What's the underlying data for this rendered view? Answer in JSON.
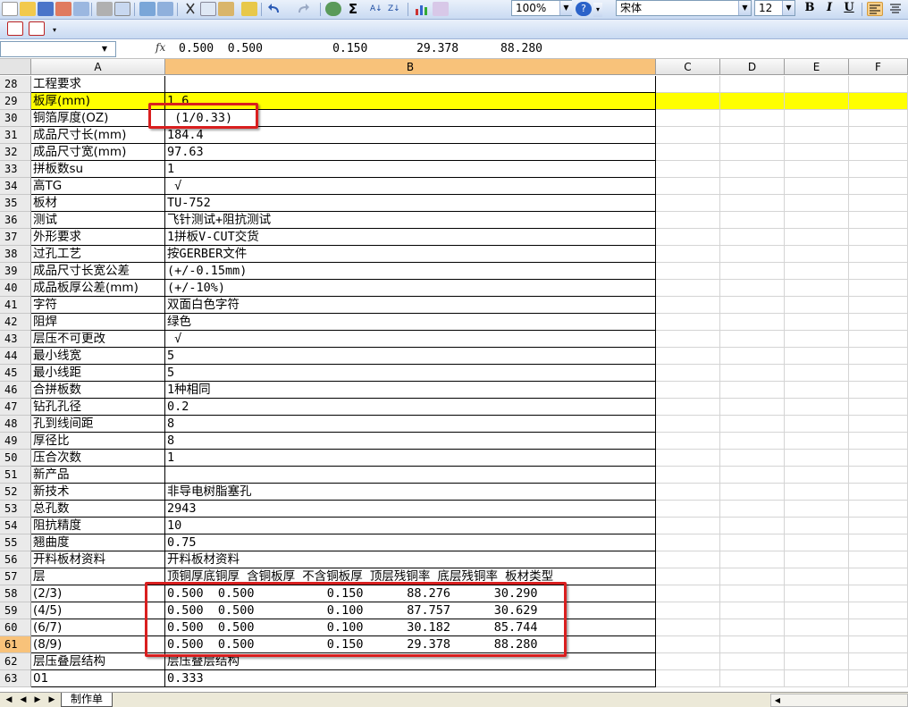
{
  "toolbar": {
    "zoom": "100%",
    "font_name": "宋体",
    "font_size": "12",
    "bold_label": "B",
    "italic_label": "I",
    "underline_label": "U",
    "sum_label": "Σ"
  },
  "formula_bar": {
    "fx_label": "fx",
    "content": "0.500  0.500          0.150       29.378      88.280"
  },
  "columns": [
    "A",
    "B",
    "C",
    "D",
    "E",
    "F"
  ],
  "rows": [
    {
      "num": "28",
      "a": "工程要求",
      "b": ""
    },
    {
      "num": "29",
      "a": "板厚(mm)",
      "b": "1.6"
    },
    {
      "num": "30",
      "a": "铜箔厚度(OZ)",
      "b": " (1/0.33)"
    },
    {
      "num": "31",
      "a": "成品尺寸长(mm)",
      "b": "184.4"
    },
    {
      "num": "32",
      "a": "成品尺寸宽(mm)",
      "b": "97.63"
    },
    {
      "num": "33",
      "a": "拼板数su",
      "b": "1"
    },
    {
      "num": "34",
      "a": "高TG",
      "b": " √"
    },
    {
      "num": "35",
      "a": "板材",
      "b": "TU-752"
    },
    {
      "num": "36",
      "a": "测试",
      "b": "飞针测试+阻抗测试"
    },
    {
      "num": "37",
      "a": "外形要求",
      "b": "1拼板V-CUT交货"
    },
    {
      "num": "38",
      "a": "过孔工艺",
      "b": "按GERBER文件"
    },
    {
      "num": "39",
      "a": "成品尺寸长宽公差",
      "b": "(+/-0.15mm)"
    },
    {
      "num": "40",
      "a": "成品板厚公差(mm)",
      "b": "(+/-10%)"
    },
    {
      "num": "41",
      "a": "字符",
      "b": "双面白色字符"
    },
    {
      "num": "42",
      "a": "阻焊",
      "b": "绿色"
    },
    {
      "num": "43",
      "a": "层压不可更改",
      "b": " √"
    },
    {
      "num": "44",
      "a": "最小线宽",
      "b": "5"
    },
    {
      "num": "45",
      "a": "最小线距",
      "b": "5"
    },
    {
      "num": "46",
      "a": "合拼板数",
      "b": "1种相同"
    },
    {
      "num": "47",
      "a": "钻孔孔径",
      "b": "0.2"
    },
    {
      "num": "48",
      "a": "孔到线间距",
      "b": "8"
    },
    {
      "num": "49",
      "a": "厚径比",
      "b": "8"
    },
    {
      "num": "50",
      "a": "压合次数",
      "b": "1"
    },
    {
      "num": "51",
      "a": "新产品",
      "b": ""
    },
    {
      "num": "52",
      "a": "新技术",
      "b": "非导电树脂塞孔"
    },
    {
      "num": "53",
      "a": "总孔数",
      "b": "2943"
    },
    {
      "num": "54",
      "a": "阻抗精度",
      "b": "10"
    },
    {
      "num": "55",
      "a": "翘曲度",
      "b": "0.75"
    },
    {
      "num": "56",
      "a": "开料板材资料",
      "b": "开料板材资料"
    },
    {
      "num": "57",
      "a": "层",
      "b": "顶铜厚底铜厚 含铜板厚 不含铜板厚 顶层残铜率 底层残铜率 板材类型"
    },
    {
      "num": "58",
      "a": "(2/3)",
      "b": "0.500  0.500          0.150      88.276      30.290"
    },
    {
      "num": "59",
      "a": "(4/5)",
      "b": "0.500  0.500          0.100      87.757      30.629"
    },
    {
      "num": "60",
      "a": "(6/7)",
      "b": "0.500  0.500          0.100      30.182      85.744"
    },
    {
      "num": "61",
      "a": "(8/9)",
      "b": "0.500  0.500          0.150      29.378      88.280"
    },
    {
      "num": "62",
      "a": "层压叠层结构",
      "b": "层压叠层结构"
    },
    {
      "num": "63",
      "a": "01",
      "b": "0.333"
    }
  ],
  "sheet_tab": "制作单",
  "colors": {
    "highlight": "#ffff00",
    "annotation": "#d91f1f",
    "active_header": "#f8c27a"
  }
}
